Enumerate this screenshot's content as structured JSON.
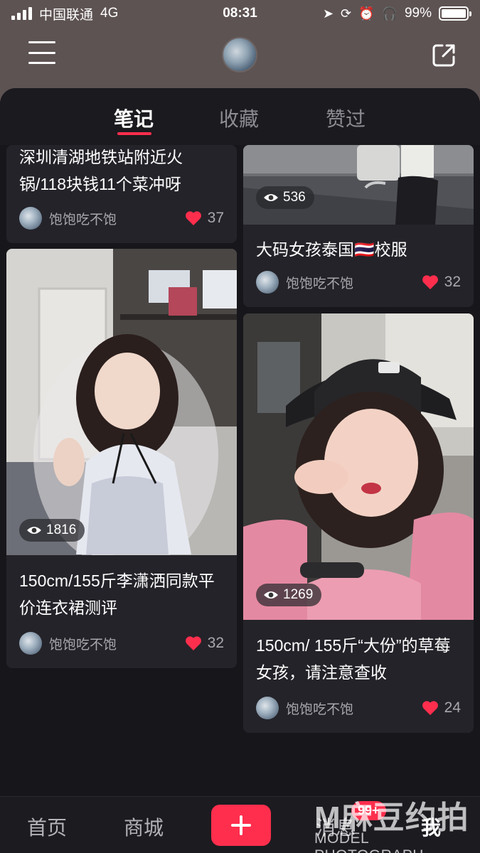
{
  "status_bar": {
    "carrier": "中国联通",
    "network": "4G",
    "time": "08:31",
    "battery": "99%",
    "battery_level": 0.99
  },
  "header": {
    "menu_icon": "menu-icon",
    "share_icon": "share-icon"
  },
  "tabs": [
    {
      "label": "笔记",
      "active": true
    },
    {
      "label": "收藏",
      "active": false
    },
    {
      "label": "赞过",
      "active": false
    }
  ],
  "notes": [
    {
      "title": "深圳清湖地铁站附近火锅/118块钱11个菜冲呀",
      "author": "饱饱吃不饱",
      "likes": "37"
    },
    {
      "title": "大码女孩泰国🇹🇭校服",
      "author": "饱饱吃不饱",
      "likes": "32",
      "views": "536"
    },
    {
      "title": "150cm/155斤李潇洒同款平价连衣裙测评",
      "author": "饱饱吃不饱",
      "likes": "32",
      "views": "1816"
    },
    {
      "title": "150cm/ 155斤“大份”的草莓女孩，请注意查收",
      "author": "饱饱吃不饱",
      "likes": "24",
      "views": "1269"
    }
  ],
  "bottom_nav": {
    "home": "首页",
    "mall": "商城",
    "messages": "消息",
    "messages_badge": "99+",
    "me": "我"
  },
  "watermark": {
    "text_big": "M麻豆约拍",
    "text_small": "MODEL PHOTOGRAPH"
  },
  "colors": {
    "accent": "#ff2e4d",
    "background": "#17161b",
    "card": "#242329",
    "header": "#5d5352"
  }
}
